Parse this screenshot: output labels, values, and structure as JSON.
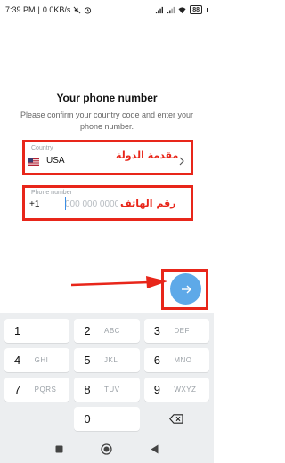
{
  "status_bar": {
    "time": "7:39 PM",
    "network_speed": "0.0KB/s",
    "battery": "88",
    "icons": [
      "mute-icon",
      "alarm-icon",
      "signal-icon",
      "signal-icon",
      "wifi-icon",
      "battery-icon"
    ]
  },
  "header": {
    "title": "Your phone number",
    "subtitle": "Please confirm your country code and enter your phone number."
  },
  "country_field": {
    "label": "Country",
    "value": "USA",
    "flag": "us-flag-icon",
    "annotation_ar": "مقدمة الدولة"
  },
  "phone_field": {
    "label": "Phone number",
    "dial_code": "+1",
    "value": "",
    "placeholder": "000 000 0000",
    "annotation_ar": "رقم الهاتف"
  },
  "next_button": {
    "icon": "arrow-right-icon"
  },
  "annotations": {
    "accent": "#e8261a",
    "arrow_color": "#e8261a"
  },
  "keypad": {
    "keys": [
      {
        "digit": "1",
        "letters": ""
      },
      {
        "digit": "2",
        "letters": "ABC"
      },
      {
        "digit": "3",
        "letters": "DEF"
      },
      {
        "digit": "4",
        "letters": "GHI"
      },
      {
        "digit": "5",
        "letters": "JKL"
      },
      {
        "digit": "6",
        "letters": "MNO"
      },
      {
        "digit": "7",
        "letters": "PQRS"
      },
      {
        "digit": "8",
        "letters": "TUV"
      },
      {
        "digit": "9",
        "letters": "WXYZ"
      },
      {
        "digit": "0",
        "letters": ""
      }
    ],
    "backspace_icon": "backspace-icon"
  },
  "nav_bar": {
    "icons": [
      "square-icon",
      "circle-icon",
      "back-triangle-icon"
    ]
  },
  "colors": {
    "accent_blue": "#5ea9e8",
    "annotation_red": "#e8261a"
  }
}
